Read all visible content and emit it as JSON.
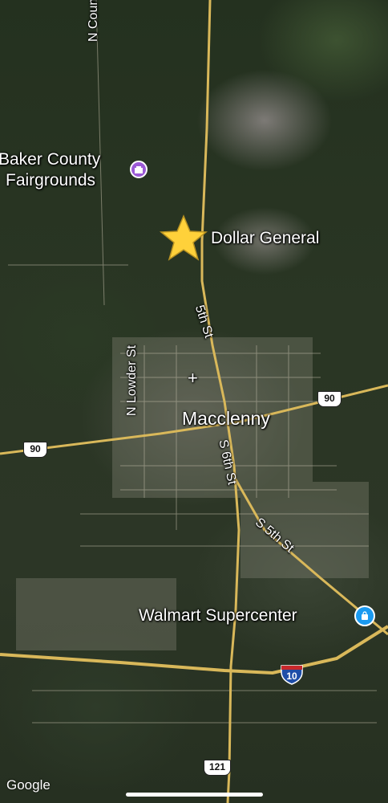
{
  "map": {
    "places": [
      {
        "id": "fairgrounds",
        "line1": "Baker County",
        "line2": "Fairgrounds",
        "pin_color": "#9b59d6",
        "icon": "landmark-icon"
      },
      {
        "id": "dollar",
        "label": "Dollar General",
        "marker": "star-icon",
        "marker_color": "#ffd13a"
      },
      {
        "id": "macclenny",
        "label": "Macclenny"
      },
      {
        "id": "walmart",
        "label": "Walmart Supercenter",
        "pin_color": "#1a9af0",
        "icon": "shopping-bag-icon"
      }
    ],
    "streets": {
      "n_county": "N Coun",
      "fifth_st": "5th St",
      "n_lowder": "N Lowder St",
      "s_sixth": "S 6th St",
      "s_fifth": "S 5th St"
    },
    "shields": {
      "us90_a": "90",
      "us90_b": "90",
      "i10": "10",
      "sr121": "121"
    },
    "attribution": "Google",
    "colors": {
      "major_road": "#d9b85a",
      "star": "#ffd13a"
    }
  }
}
